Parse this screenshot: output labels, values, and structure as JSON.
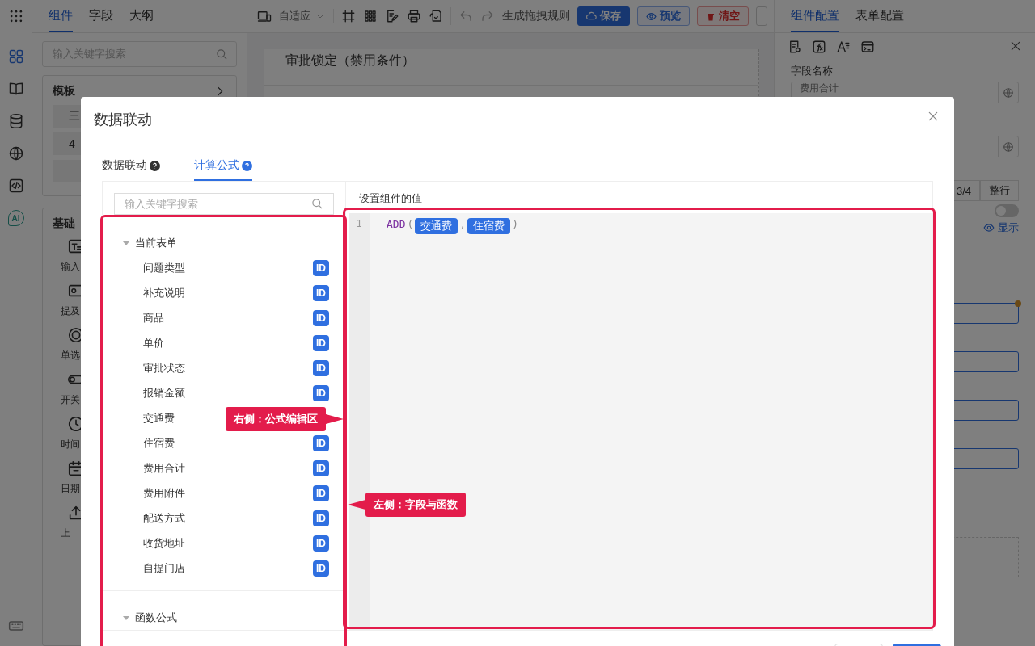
{
  "rail": [
    {
      "kind": "components",
      "selected": true
    },
    {
      "kind": "book",
      "selected": false
    },
    {
      "kind": "database",
      "selected": false
    },
    {
      "kind": "globe",
      "selected": false
    },
    {
      "kind": "code",
      "selected": false
    },
    {
      "kind": "ai",
      "selected": false,
      "label": "AI"
    }
  ],
  "left_tabs": [
    {
      "label": "组件",
      "selected": true
    },
    {
      "label": "字段",
      "selected": false
    },
    {
      "label": "大纲",
      "selected": false
    }
  ],
  "left_search": {
    "placeholder": "输入关键字搜索"
  },
  "template_panel": {
    "title": "模板",
    "items": [
      "三",
      "4"
    ]
  },
  "basic_panel": {
    "title": "基础",
    "components": [
      {
        "kind": "text",
        "label": "输入"
      },
      {
        "kind": "mention",
        "label": "提及"
      },
      {
        "kind": "radio",
        "label": "单选"
      },
      {
        "kind": "switch",
        "label": "开关"
      },
      {
        "kind": "time",
        "label": "时间"
      },
      {
        "kind": "date",
        "label": "日期"
      },
      {
        "kind": "upload",
        "label": "上"
      }
    ]
  },
  "toolbar": {
    "layout_select": "自适应",
    "generate": "生成拖拽规则",
    "buttons": [
      {
        "kind": "primary",
        "label": "保存"
      },
      {
        "kind": "outline",
        "label": "预览"
      },
      {
        "kind": "danger",
        "label": "清空"
      }
    ]
  },
  "canvas": {
    "field_title": "审批锁定（禁用条件）"
  },
  "right_tabs": [
    {
      "label": "组件配置",
      "selected": true
    },
    {
      "label": "表单配置",
      "selected": false
    }
  ],
  "config": {
    "field_name_label": "字段名称",
    "field_name_value": "费用合计",
    "width_options": [
      "3/4",
      "整行"
    ],
    "toggle": {
      "on": false
    },
    "visibility_link": "显示"
  },
  "modal": {
    "title": "数据联动",
    "tabs": [
      {
        "label": "数据联动",
        "selected": false
      },
      {
        "label": "计算公式",
        "selected": true
      }
    ],
    "search": {
      "placeholder": "输入关键字搜索"
    },
    "tree": [
      {
        "label": "当前表单",
        "expanded": true,
        "children": [
          {
            "label": "问题类型",
            "badge": "ID"
          },
          {
            "label": "补充说明",
            "badge": "ID"
          },
          {
            "label": "商品",
            "badge": "ID"
          },
          {
            "label": "单价",
            "badge": "ID"
          },
          {
            "label": "审批状态",
            "badge": "ID"
          },
          {
            "label": "报销金额",
            "badge": "ID"
          },
          {
            "label": "交通费"
          },
          {
            "label": "住宿费",
            "badge": "ID"
          },
          {
            "label": "费用合计",
            "badge": "ID"
          },
          {
            "label": "费用附件",
            "badge": "ID"
          },
          {
            "label": "配送方式",
            "badge": "ID"
          },
          {
            "label": "收货地址",
            "badge": "ID"
          },
          {
            "label": "自提门店",
            "badge": "ID"
          }
        ]
      },
      {
        "label": "函数公式",
        "expanded": true
      }
    ],
    "editor": {
      "label": "设置组件的值",
      "line_number": "1",
      "tokens": [
        {
          "kind": "func",
          "text": "ADD"
        },
        {
          "kind": "punct",
          "text": "("
        },
        {
          "kind": "field",
          "text": "交通费"
        },
        {
          "kind": "punct",
          "text": ","
        },
        {
          "kind": "field",
          "text": "住宿费"
        },
        {
          "kind": "punct",
          "text": ")"
        }
      ]
    },
    "footer_buttons": [
      {
        "kind": "default"
      },
      {
        "kind": "primary"
      }
    ]
  },
  "annotations": [
    {
      "kind": "point-right",
      "text": "右侧：公式编辑区"
    },
    {
      "kind": "point-left",
      "text": "左侧：字段与函数"
    }
  ]
}
